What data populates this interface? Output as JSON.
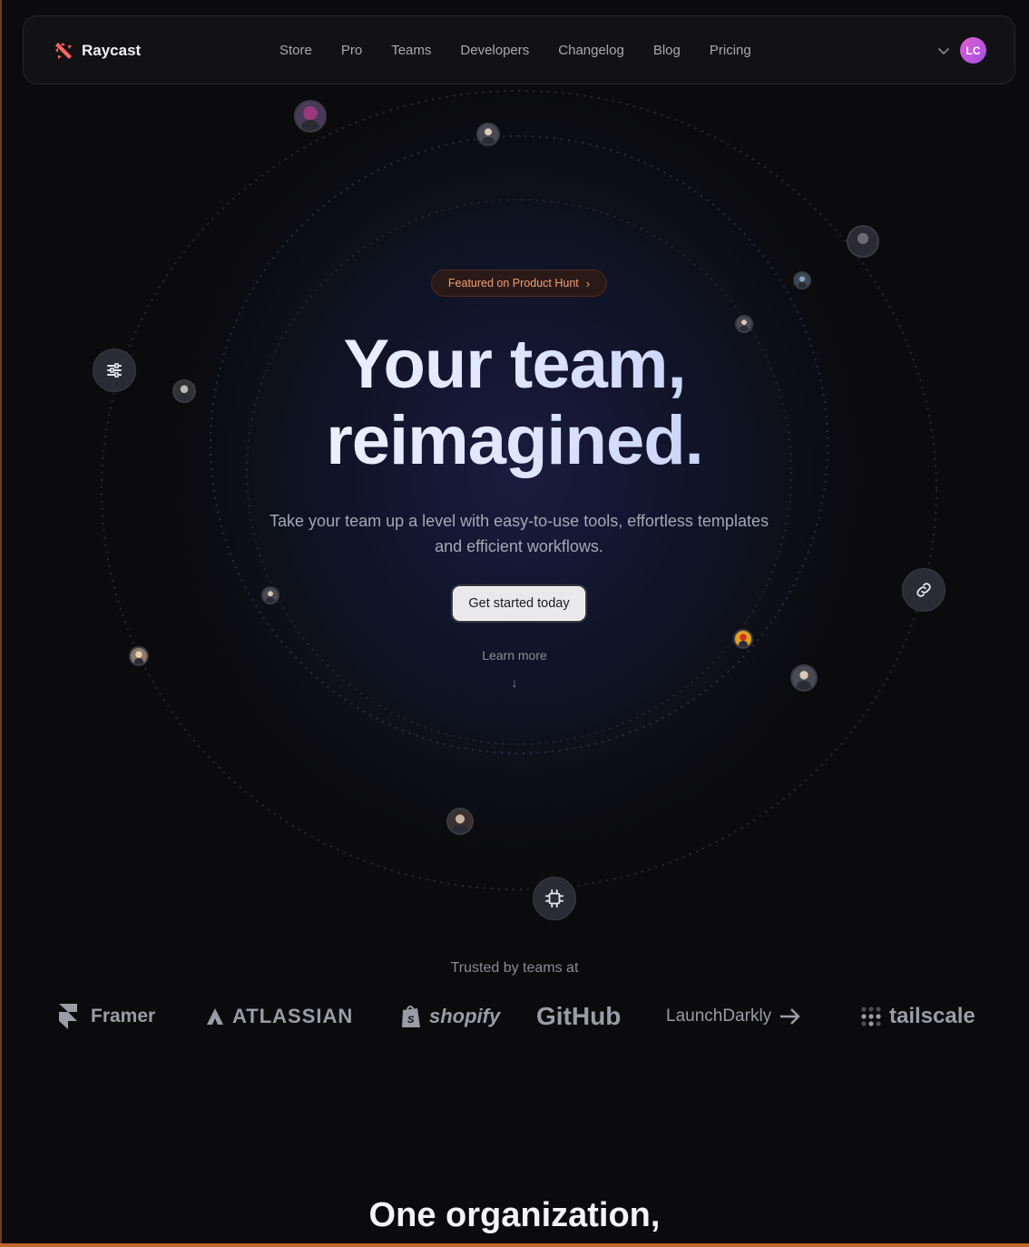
{
  "nav": {
    "brand": "Raycast",
    "links": [
      "Store",
      "Pro",
      "Teams",
      "Developers",
      "Changelog",
      "Blog",
      "Pricing"
    ],
    "avatar_initials": "LC",
    "avatar_color": "#c356e0"
  },
  "hero": {
    "badge": "Featured on Product Hunt",
    "title_line1": "Your team,",
    "title_line2": "reimagined.",
    "subtitle": "Take your team up a level with easy-to-use tools, effortless templates and efficient workflows.",
    "cta": "Get started today",
    "learn_more": "Learn more",
    "learn_arrow": "↓"
  },
  "orbit_icons": [
    "filter-icon",
    "link-icon",
    "chip-icon"
  ],
  "trusted": {
    "label": "Trusted by teams at",
    "logos": [
      "Framer",
      "ATLASSIAN",
      "shopify",
      "GitHub",
      "LaunchDarkly",
      "tailscale"
    ]
  },
  "next_section": {
    "title": "One organization,"
  },
  "colors": {
    "accent": "#ff6363",
    "badge_text": "#f0a070",
    "background": "#0b0b0d"
  }
}
